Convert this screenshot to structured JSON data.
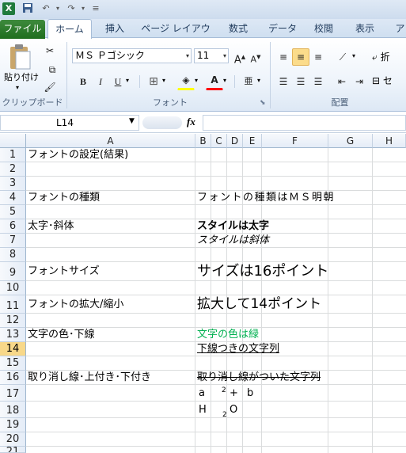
{
  "qat": {
    "icons": [
      "excel-icon",
      "save-icon",
      "undo-icon",
      "redo-icon",
      "customize-icon"
    ]
  },
  "tabs": {
    "file": "ファイル",
    "home": "ホーム",
    "insert": "挿入",
    "page_layout": "ページ レイアウト",
    "formulas": "数式",
    "data": "データ",
    "review": "校閲",
    "view": "表示",
    "addins": "ア"
  },
  "ribbon": {
    "clipboard": {
      "paste_label": "貼り付け",
      "group_label": "クリップボード"
    },
    "font": {
      "font_name": "ＭＳ Ｐゴシック",
      "font_size": "11",
      "bold": "B",
      "italic": "I",
      "underline": "U",
      "color_letter": "A",
      "phonetic": "亜",
      "grow": "A",
      "shrink": "A",
      "group_label": "フォント"
    },
    "align": {
      "wrap_label": "折",
      "merge_label": "セ",
      "group_label": "配置"
    }
  },
  "formula_bar": {
    "name_box": "L14",
    "fx": "fx",
    "formula": ""
  },
  "columns": [
    "A",
    "B",
    "C",
    "D",
    "E",
    "F",
    "G",
    "H"
  ],
  "rows": [
    "1",
    "2",
    "3",
    "4",
    "5",
    "6",
    "7",
    "8",
    "9",
    "10",
    "11",
    "12",
    "13",
    "14",
    "15",
    "16",
    "17",
    "18",
    "19",
    "20",
    "21"
  ],
  "selected_row": "14",
  "colors": {
    "green_text": "#00b050",
    "accent_file": "#217346",
    "selected_header": "#f8d889"
  },
  "cells": {
    "a1": "フォントの設定(結果)",
    "a4": "フォントの種類",
    "b4": "フォントの種類はＭＳ明朝",
    "a6": "太字･斜体",
    "b6": "スタイルは太字",
    "b7": "スタイルは斜体",
    "a9": "フォントサイズ",
    "b9": "サイズは16ポイント",
    "a11": "フォントの拡大/縮小",
    "b11": "拡大して14ポイント",
    "a13": "文字の色･下線",
    "b13": "文字の色は緑",
    "b14": "下線つきの文字列",
    "a16": "取り消し線･上付き･下付き",
    "b16": "取り消し線がついた文字列",
    "b17": "a",
    "c17_sup": "2",
    "c17_plus": "+",
    "e17": "b",
    "b18": "H",
    "c18_sub": "2",
    "d18": "O"
  }
}
